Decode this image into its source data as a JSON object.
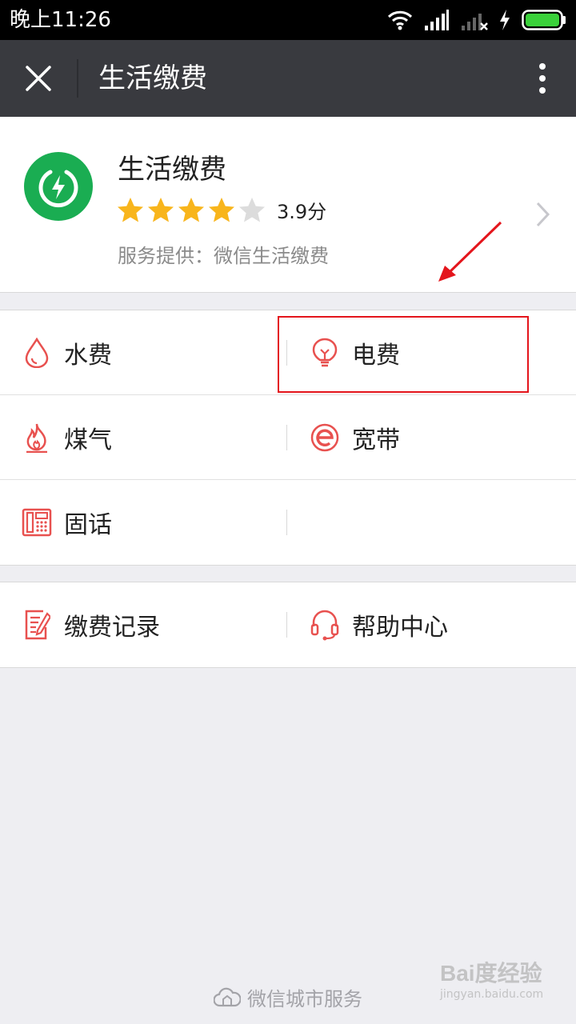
{
  "status_bar": {
    "time": "晚上11:26"
  },
  "title_bar": {
    "title": "生活缴费"
  },
  "service": {
    "name": "生活缴费",
    "rating": 3.9,
    "rating_max": 5,
    "rating_text": "3.9分",
    "provider": "服务提供：微信生活缴费",
    "logo_color": "#1aad52"
  },
  "colors": {
    "accent_icon": "#e8514f",
    "star_filled": "#f8b51c",
    "star_empty": "#dcdcdc",
    "highlight": "#e4151c"
  },
  "services_grid": {
    "rows": [
      {
        "left": {
          "label": "水费",
          "icon": "water-drop-icon"
        },
        "right": {
          "label": "电费",
          "icon": "light-bulb-icon"
        }
      },
      {
        "left": {
          "label": "煤气",
          "icon": "flame-icon"
        },
        "right": {
          "label": "宽带",
          "icon": "broadband-e-icon"
        }
      },
      {
        "left": {
          "label": "固话",
          "icon": "landline-phone-icon"
        },
        "right": null
      }
    ]
  },
  "bottom_grid": {
    "left": {
      "label": "缴费记录",
      "icon": "records-icon"
    },
    "right": {
      "label": "帮助中心",
      "icon": "headset-icon"
    }
  },
  "footer": {
    "text": "微信城市服务",
    "icon": "cloud-icon"
  },
  "watermark": {
    "brand": "Bai度经验",
    "url": "jingyan.baidu.com"
  }
}
